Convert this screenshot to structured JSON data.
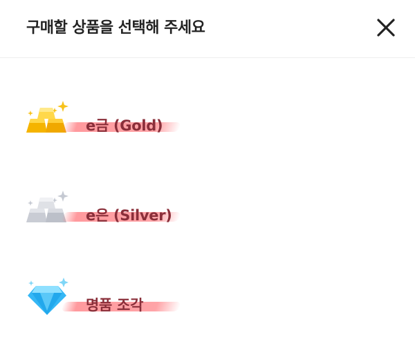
{
  "dialog": {
    "title": "구매할 상품을 선택해 주세요",
    "close_icon": "close-icon"
  },
  "products": [
    {
      "label": "e금 (Gold)",
      "icon": "gold-bars-icon",
      "color": "#f5b400"
    },
    {
      "label": "e은 (Silver)",
      "icon": "silver-bars-icon",
      "color": "#c9ccd4"
    },
    {
      "label": "명품 조각",
      "icon": "diamond-icon",
      "color": "#35b7f5"
    }
  ],
  "colors": {
    "label_text": "#8a2f3a",
    "highlight": "#ff7b82",
    "title_text": "#222222"
  }
}
